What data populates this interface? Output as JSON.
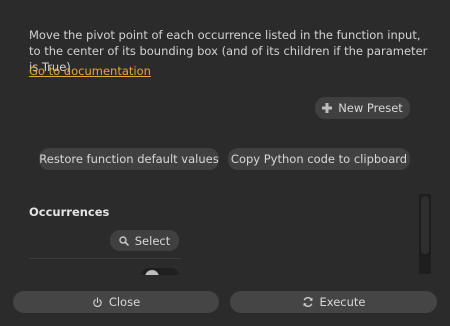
{
  "description": "Move the pivot point of each occurrence listed in the function input, to the center of its bounding box (and of its children if the parameter is True)",
  "doc_link": "Go to documentation",
  "buttons": {
    "new_preset": "New Preset",
    "restore_defaults": "Restore function default values",
    "copy_python": "Copy Python code to clipboard",
    "select": "Select",
    "close": "Close",
    "execute": "Execute"
  },
  "occurrences": {
    "title": "Occurrences"
  },
  "icons": {
    "new_preset": "plus-icon",
    "select": "search-icon",
    "close": "power-icon",
    "execute": "refresh-icon"
  },
  "colors": {
    "background": "#2b2b2b",
    "button": "#404040",
    "link": "#e6a635"
  }
}
